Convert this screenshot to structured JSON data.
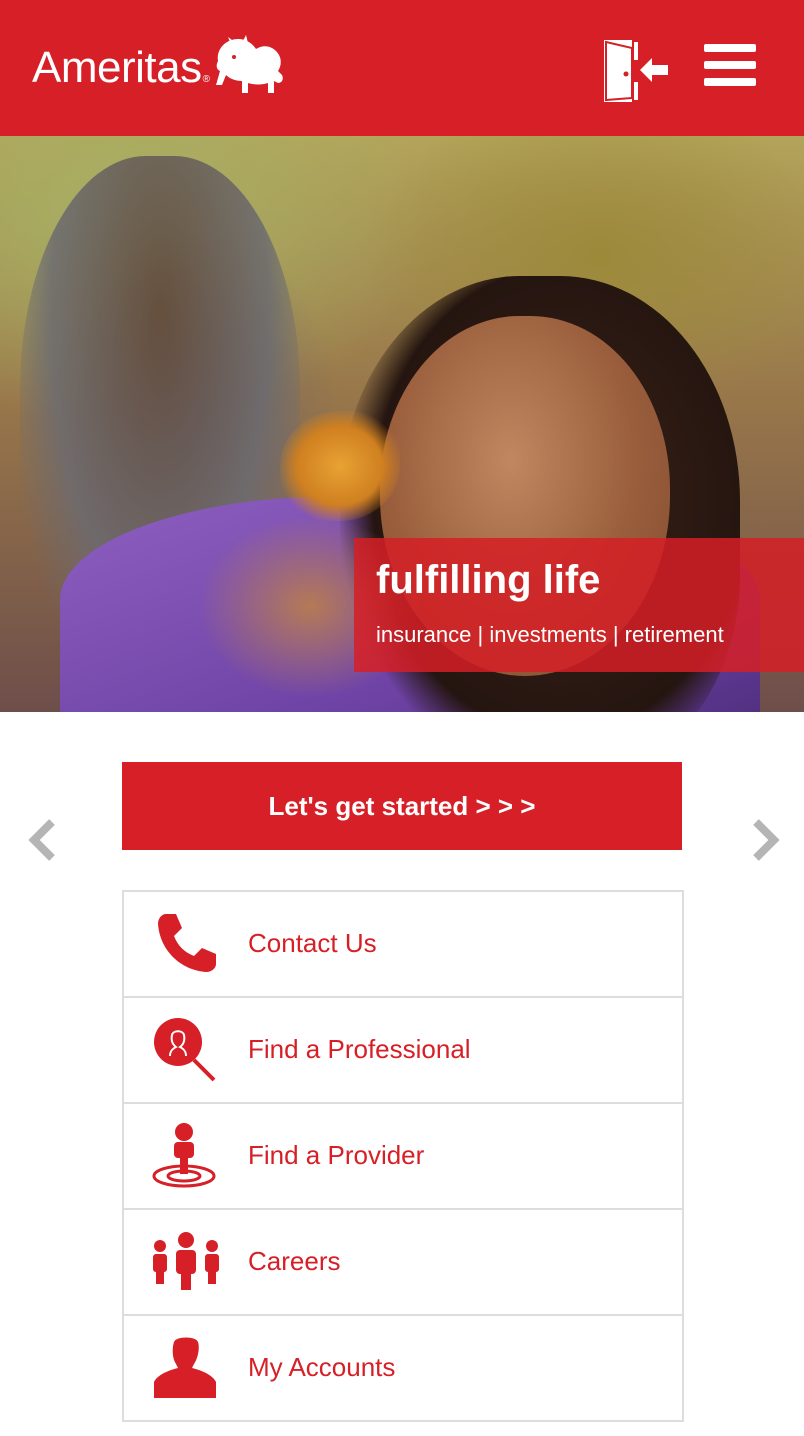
{
  "header": {
    "logo_text": "Ameritas",
    "logo_mark": "®",
    "login_icon": "login-door-icon",
    "menu_icon": "hamburger-menu-icon"
  },
  "hero": {
    "title": "fulfilling life",
    "subtitle": "insurance | investments | retirement"
  },
  "carousel": {
    "prev_icon": "chevron-left-icon",
    "next_icon": "chevron-right-icon"
  },
  "cta": {
    "label": "Let's get started > > >"
  },
  "links": [
    {
      "label": "Contact Us",
      "icon": "phone-icon"
    },
    {
      "label": "Find a Professional",
      "icon": "search-person-icon"
    },
    {
      "label": "Find a Provider",
      "icon": "location-person-icon"
    },
    {
      "label": "Careers",
      "icon": "people-group-icon"
    },
    {
      "label": "My Accounts",
      "icon": "user-icon"
    }
  ],
  "colors": {
    "brand": "#d61f26",
    "border": "#dddddd",
    "arrow": "#b5b5b5"
  }
}
